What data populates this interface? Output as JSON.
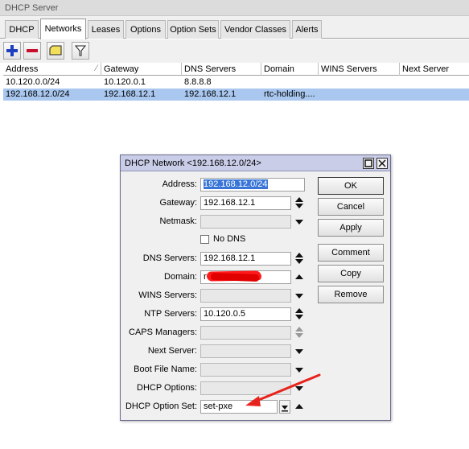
{
  "window": {
    "title": "DHCP Server"
  },
  "tabs": [
    {
      "label": "DHCP"
    },
    {
      "label": "Networks",
      "active": true
    },
    {
      "label": "Leases"
    },
    {
      "label": "Options"
    },
    {
      "label": "Option Sets"
    },
    {
      "label": "Vendor Classes"
    },
    {
      "label": "Alerts"
    }
  ],
  "toolbar": {
    "icons": [
      "add-icon",
      "remove-icon",
      "comment-icon",
      "filter-icon"
    ],
    "colors": {
      "add": "#1f3fbf",
      "remove": "#c8102e",
      "comment": "#f3e05a"
    }
  },
  "table": {
    "columns": [
      "Address",
      "Gateway",
      "DNS Servers",
      "Domain",
      "WINS Servers",
      "Next Server"
    ],
    "rows": [
      [
        "10.120.0.0/24",
        "10.120.0.1",
        "8.8.8.8",
        "",
        "",
        ""
      ],
      [
        "192.168.12.0/24",
        "192.168.12.1",
        "192.168.12.1",
        "rtc-holding....",
        "",
        ""
      ]
    ],
    "selected_row": 1
  },
  "dialog": {
    "title": "DHCP Network <192.168.12.0/24>",
    "fields": {
      "address": {
        "label": "Address:",
        "value": "192.168.12.0/24"
      },
      "gateway": {
        "label": "Gateway:",
        "value": "192.168.12.1"
      },
      "netmask": {
        "label": "Netmask:",
        "value": ""
      },
      "no_dns": {
        "label": "No DNS",
        "checked": false
      },
      "dns_servers": {
        "label": "DNS Servers:",
        "value": "192.168.12.1"
      },
      "domain": {
        "label": "Domain:",
        "value": "r"
      },
      "wins_servers": {
        "label": "WINS Servers:",
        "value": ""
      },
      "ntp_servers": {
        "label": "NTP Servers:",
        "value": "10.120.0.5"
      },
      "caps_managers": {
        "label": "CAPS Managers:",
        "value": ""
      },
      "next_server": {
        "label": "Next Server:",
        "value": ""
      },
      "boot_file_name": {
        "label": "Boot File Name:",
        "value": ""
      },
      "dhcp_options": {
        "label": "DHCP Options:",
        "value": ""
      },
      "dhcp_option_set": {
        "label": "DHCP Option Set:",
        "value": "set-pxe"
      }
    },
    "buttons": {
      "ok": "OK",
      "cancel": "Cancel",
      "apply": "Apply",
      "comment": "Comment",
      "copy": "Copy",
      "remove": "Remove"
    },
    "annotation_color": "#e8231e"
  }
}
